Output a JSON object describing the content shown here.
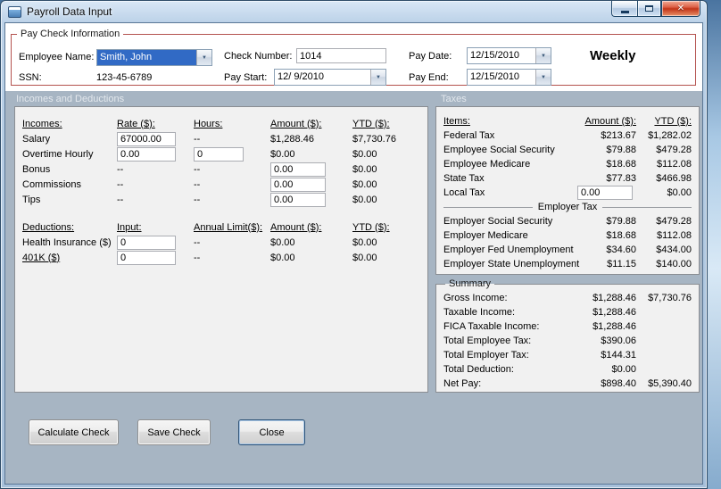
{
  "window": {
    "title": "Payroll Data Input",
    "close_glyph": "✕"
  },
  "colors": {
    "paycheck_border": "#b4524e",
    "selection_blue": "#316ac5",
    "panel_background": "#a7b5c3",
    "close_button_red": "#c23418"
  },
  "paycheck": {
    "legend": "Pay Check Information",
    "employee_name_label": "Employee Name:",
    "employee_name_value": "Smith, John",
    "ssn_label": "SSN:",
    "ssn_value": "123-45-6789",
    "check_number_label": "Check Number:",
    "check_number_value": "1014",
    "pay_start_label": "Pay Start:",
    "pay_start_value": "12/ 9/2010",
    "pay_date_label": "Pay Date:",
    "pay_date_value": "12/15/2010",
    "pay_end_label": "Pay End:",
    "pay_end_value": "12/15/2010",
    "frequency": "Weekly",
    "dropdown_arrow": "▼"
  },
  "bands": {
    "left": "Incomes and Deductions",
    "right": "Taxes"
  },
  "incomes": {
    "headers": {
      "c1": "Incomes:",
      "c2": "Rate ($):",
      "c3": "Hours:",
      "c4": "Amount ($):",
      "c5": "YTD ($):"
    },
    "rows": [
      {
        "label": "Salary",
        "rate": "67000.00",
        "hours": "--",
        "amount": "$1,288.46",
        "ytd": "$7,730.76"
      },
      {
        "label": "Overtime Hourly",
        "rate": "0.00",
        "hours": "0",
        "amount": "$0.00",
        "ytd": "$0.00"
      },
      {
        "label": "Bonus",
        "rate": "--",
        "hours": "--",
        "amount": "0.00",
        "ytd": "$0.00"
      },
      {
        "label": "Commissions",
        "rate": "--",
        "hours": "--",
        "amount": "0.00",
        "ytd": "$0.00"
      },
      {
        "label": "Tips",
        "rate": "--",
        "hours": "--",
        "amount": "0.00",
        "ytd": "$0.00"
      }
    ]
  },
  "deductions": {
    "headers": {
      "c1": "Deductions:",
      "c2": "Input:",
      "c3": "Annual Limit($):",
      "c4": "Amount ($):",
      "c5": "YTD ($):"
    },
    "rows": [
      {
        "label": "Health Insurance  ($)",
        "input": "0",
        "limit": "--",
        "amount": "$0.00",
        "ytd": "$0.00"
      },
      {
        "label": "401K  ($)",
        "input": "0",
        "limit": "--",
        "amount": "$0.00",
        "ytd": "$0.00"
      }
    ]
  },
  "taxes": {
    "headers": {
      "c1": "Items:",
      "c2": "Amount ($):",
      "c3": "YTD ($):"
    },
    "employee_rows": [
      {
        "label": "Federal Tax",
        "amount": "$213.67",
        "ytd": "$1,282.02"
      },
      {
        "label": "Employee Social Security",
        "amount": "$79.88",
        "ytd": "$479.28"
      },
      {
        "label": "Employee Medicare",
        "amount": "$18.68",
        "ytd": "$112.08"
      },
      {
        "label": "State Tax",
        "amount": "$77.83",
        "ytd": "$466.98"
      },
      {
        "label": "Local Tax",
        "amount": "0.00",
        "ytd": "$0.00"
      }
    ],
    "employer_header": "Employer Tax",
    "employer_rows": [
      {
        "label": "Employer Social Security",
        "amount": "$79.88",
        "ytd": "$479.28"
      },
      {
        "label": "Employer Medicare",
        "amount": "$18.68",
        "ytd": "$112.08"
      },
      {
        "label": "Employer Fed Unemployment",
        "amount": "$34.60",
        "ytd": "$434.00"
      },
      {
        "label": "Employer State Unemployment",
        "amount": "$11.15",
        "ytd": "$140.00"
      }
    ]
  },
  "summary": {
    "legend": "Summary",
    "rows": [
      {
        "label": "Gross Income:",
        "amount": "$1,288.46",
        "ytd": "$7,730.76"
      },
      {
        "label": "Taxable Income:",
        "amount": "$1,288.46",
        "ytd": ""
      },
      {
        "label": "FICA Taxable Income:",
        "amount": "$1,288.46",
        "ytd": ""
      },
      {
        "label": "Total Employee Tax:",
        "amount": "$390.06",
        "ytd": ""
      },
      {
        "label": "Total Employer Tax:",
        "amount": "$144.31",
        "ytd": ""
      },
      {
        "label": "Total Deduction:",
        "amount": "$0.00",
        "ytd": ""
      },
      {
        "label": "Net Pay:",
        "amount": "$898.40",
        "ytd": "$5,390.40"
      }
    ]
  },
  "buttons": {
    "calculate": "Calculate Check",
    "save": "Save Check",
    "close": "Close"
  }
}
